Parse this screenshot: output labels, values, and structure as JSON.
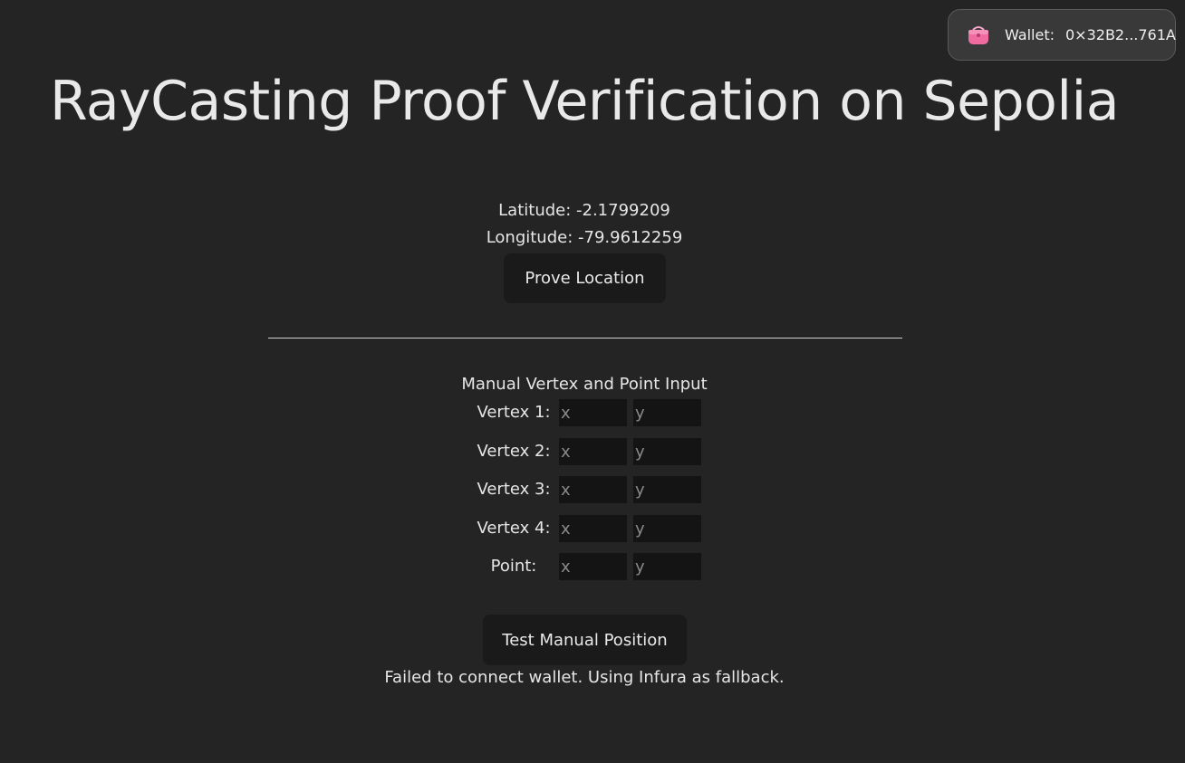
{
  "wallet": {
    "icon": "wallet-purse-icon",
    "label": "Wallet:",
    "address": "0×32B2...761A"
  },
  "header": {
    "title": "RayCasting Proof Verification on Sepolia"
  },
  "location": {
    "latitude": "Latitude: -2.1799209",
    "longitude": "Longitude: -79.9612259",
    "prove_button": "Prove Location"
  },
  "manual": {
    "title": "Manual Vertex and Point Input",
    "rows": [
      {
        "label": "Vertex 1:",
        "x_placeholder": "x",
        "y_placeholder": "y"
      },
      {
        "label": "Vertex 2:",
        "x_placeholder": "x",
        "y_placeholder": "y"
      },
      {
        "label": "Vertex 3:",
        "x_placeholder": "x",
        "y_placeholder": "y"
      },
      {
        "label": "Vertex 4:",
        "x_placeholder": "x",
        "y_placeholder": "y"
      },
      {
        "label": "Point:",
        "x_placeholder": "x",
        "y_placeholder": "y"
      }
    ],
    "test_button": "Test Manual Position"
  },
  "status": {
    "message": "Failed to connect wallet. Using Infura as fallback."
  },
  "colors": {
    "background": "#242424",
    "button_bg": "#1a1a1a",
    "input_bg": "#141414",
    "wallet_pill_bg": "#393939"
  }
}
